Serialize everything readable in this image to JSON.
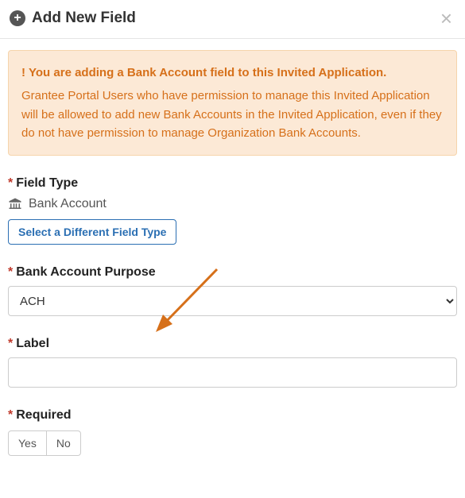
{
  "header": {
    "title": "Add New Field"
  },
  "alert": {
    "headline": "You are adding a Bank Account field to this Invited Application.",
    "body": "Grantee Portal Users who have permission to manage this Invited Application will be allowed to add new Bank Accounts in the Invited Application, even if they do not have permission to manage Organization Bank Accounts."
  },
  "fieldType": {
    "label": "Field Type",
    "value": "Bank Account",
    "changeButton": "Select a Different Field Type"
  },
  "purpose": {
    "label": "Bank Account Purpose",
    "selected": "ACH",
    "options": [
      "ACH"
    ]
  },
  "label": {
    "label": "Label",
    "value": ""
  },
  "required": {
    "label": "Required",
    "yes": "Yes",
    "no": "No"
  }
}
